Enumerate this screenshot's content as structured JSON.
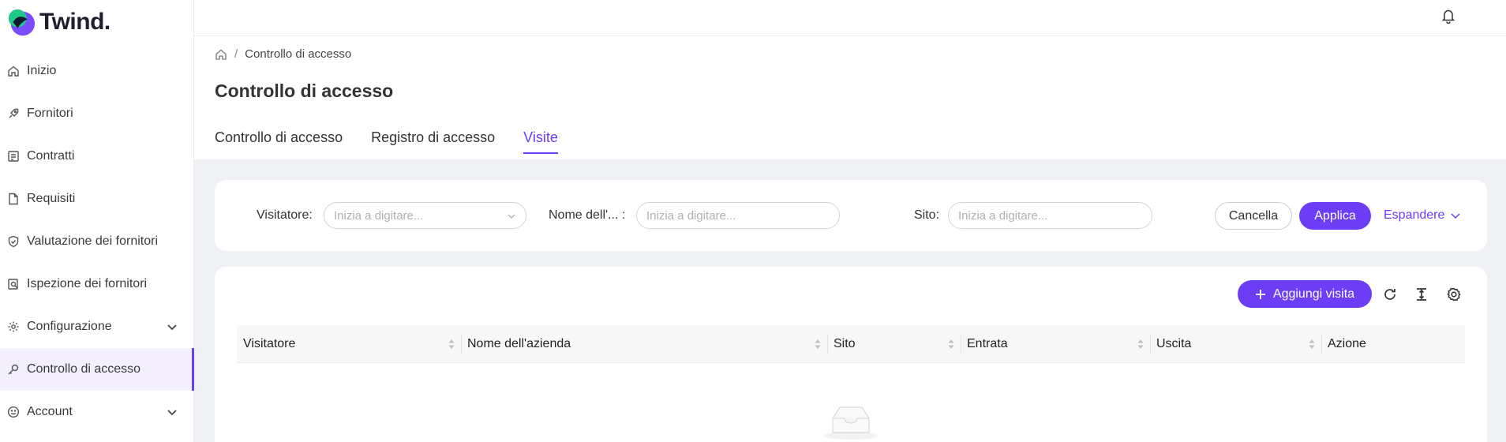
{
  "app": {
    "logo_text": "Twind."
  },
  "sidebar": {
    "items": [
      {
        "label": "Inizio",
        "icon": "home-icon"
      },
      {
        "label": "Fornitori",
        "icon": "rocket-icon"
      },
      {
        "label": "Contratti",
        "icon": "contract-icon"
      },
      {
        "label": "Requisiti",
        "icon": "document-icon"
      },
      {
        "label": "Valutazione dei fornitori",
        "icon": "shield-check-icon"
      },
      {
        "label": "Ispezione dei fornitori",
        "icon": "search-document-icon"
      },
      {
        "label": "Configurazione",
        "icon": "gear-icon"
      },
      {
        "label": "Controllo di accesso",
        "icon": "key-icon"
      },
      {
        "label": "Account",
        "icon": "smile-icon"
      }
    ]
  },
  "breadcrumb": {
    "current": "Controllo di accesso"
  },
  "page": {
    "title": "Controllo di accesso"
  },
  "tabs": [
    {
      "label": "Controllo di accesso"
    },
    {
      "label": "Registro di accesso"
    },
    {
      "label": "Visite"
    }
  ],
  "filters": {
    "visitor": {
      "label": "Visitatore",
      "placeholder": "Inizia a digitare..."
    },
    "company": {
      "label": "Nome dell'...",
      "placeholder": "Inizia a digitare..."
    },
    "site": {
      "label": "Sito",
      "placeholder": "Inizia a digitare..."
    },
    "cancel_label": "Cancella",
    "apply_label": "Applica",
    "expand_label": "Espandere"
  },
  "toolbar": {
    "add_label": "Aggiungi visita"
  },
  "table": {
    "columns": [
      "Visitatore",
      "Nome dell'azienda",
      "Sito",
      "Entrata",
      "Uscita",
      "Azione"
    ]
  },
  "colors": {
    "accent": "#6b3df5",
    "logo_green": "#1fc98a",
    "logo_purple": "#7b4dff"
  }
}
